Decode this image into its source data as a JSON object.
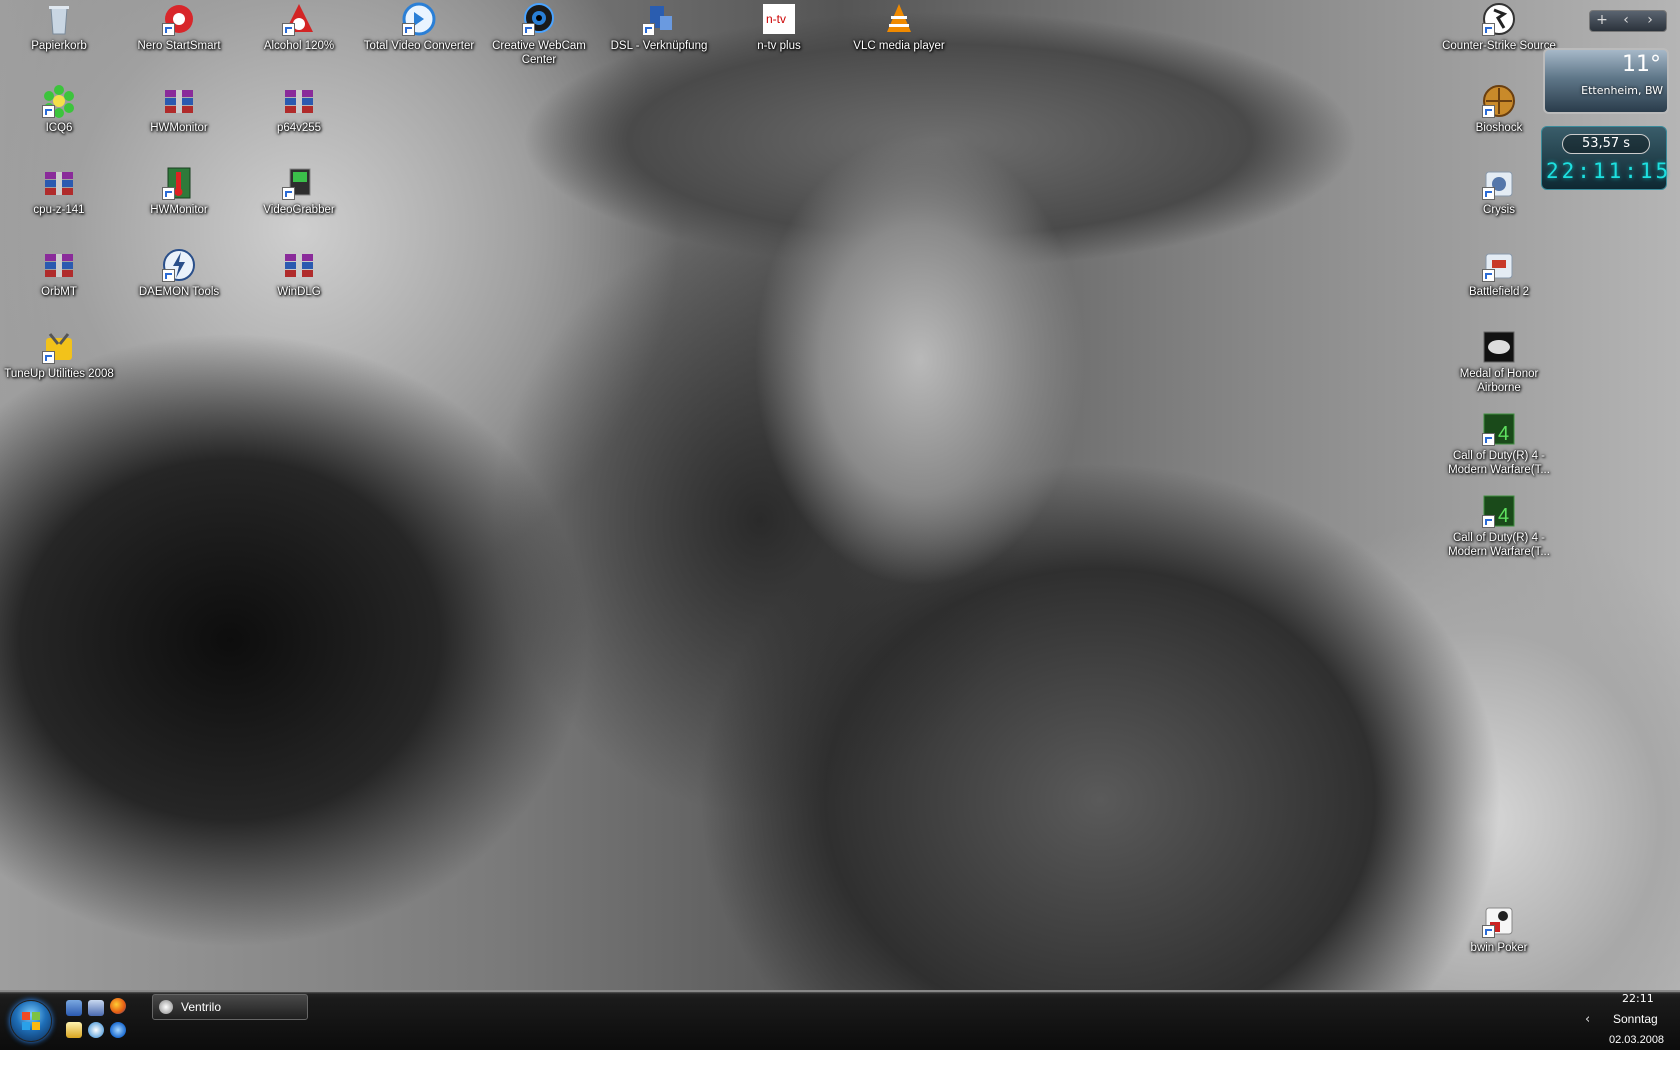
{
  "desktop": {
    "icons": [
      {
        "label": "Papierkorb",
        "icon": "recycle-bin-icon"
      },
      {
        "label": "Nero StartSmart",
        "icon": "nero-icon"
      },
      {
        "label": "Alcohol 120%",
        "icon": "alcohol-icon"
      },
      {
        "label": "Total Video Converter",
        "icon": "total-video-converter-icon"
      },
      {
        "label": "Creative WebCam Center",
        "icon": "webcam-icon"
      },
      {
        "label": "DSL - Verknüpfung",
        "icon": "dsl-icon"
      },
      {
        "label": "n-tv plus",
        "icon": "ntv-icon"
      },
      {
        "label": "VLC media player",
        "icon": "vlc-icon"
      },
      {
        "label": "ICQ6",
        "icon": "icq-icon"
      },
      {
        "label": "HWMonitor",
        "icon": "winrar-icon"
      },
      {
        "label": "p64v255",
        "icon": "winrar-icon"
      },
      {
        "label": "cpu-z-141",
        "icon": "winrar-icon"
      },
      {
        "label": "HWMonitor",
        "icon": "hwmonitor-icon"
      },
      {
        "label": "VideoGrabber",
        "icon": "videograbber-icon"
      },
      {
        "label": "OrbMT",
        "icon": "winrar-icon"
      },
      {
        "label": "DAEMON Tools",
        "icon": "daemon-tools-icon"
      },
      {
        "label": "WinDLG",
        "icon": "winrar-icon"
      },
      {
        "label": "TuneUp Utilities 2008",
        "icon": "tuneup-icon"
      },
      {
        "label": "Counter-Strike Source",
        "icon": "counter-strike-icon"
      },
      {
        "label": "Bioshock",
        "icon": "bioshock-icon"
      },
      {
        "label": "Crysis",
        "icon": "crysis-icon"
      },
      {
        "label": "Battlefield 2",
        "icon": "battlefield-icon"
      },
      {
        "label": "Medal of Honor Airborne",
        "icon": "medal-of-honor-icon"
      },
      {
        "label": "Call of Duty(R) 4 - Modern Warfare(T...",
        "icon": "call-of-duty-icon"
      },
      {
        "label": "Call of Duty(R) 4 - Modern Warfare(T...",
        "icon": "call-of-duty-icon"
      },
      {
        "label": "bwin Poker",
        "icon": "bwin-poker-icon"
      }
    ]
  },
  "gadgets": {
    "toolbar": {
      "add": "+",
      "prev": "‹",
      "next": "›"
    },
    "weather": {
      "temperature": "11°",
      "location": "Ettenheim, BW"
    },
    "clock": {
      "timer": "53,57 s",
      "time": "22:11:15"
    }
  },
  "taskbar": {
    "task_button": "Ventrilo",
    "tray": {
      "time": "22:11",
      "arrow": "‹",
      "day": "Sonntag",
      "date": "02.03.2008"
    }
  },
  "colors": {
    "clock_digits": "#1ee0e0",
    "taskbar": "#0b0b0b"
  }
}
